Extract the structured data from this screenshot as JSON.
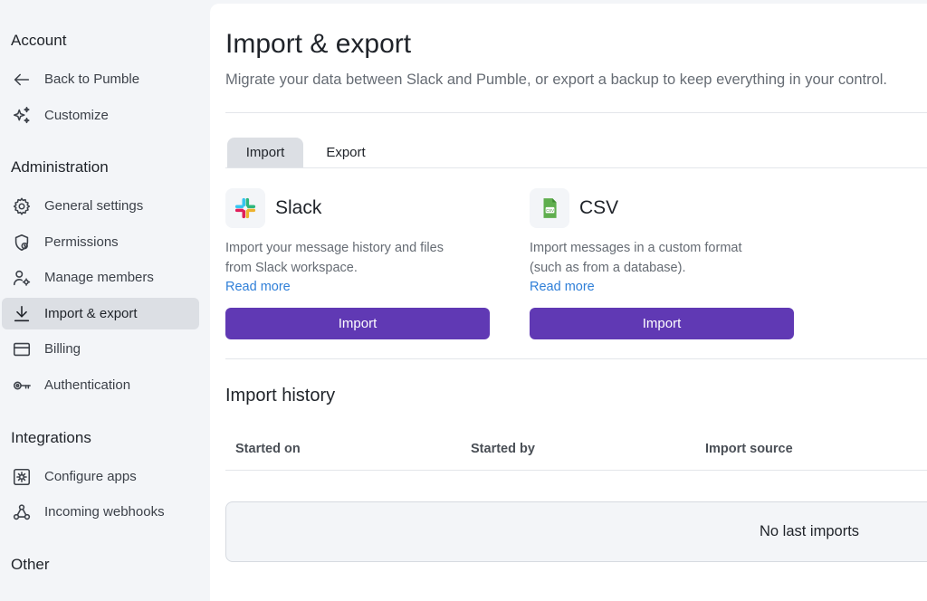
{
  "sidebar": {
    "account_title": "Account",
    "account_items": [
      {
        "label": "Back to Pumble",
        "icon": "arrow-left-icon"
      },
      {
        "label": "Customize",
        "icon": "sparkle-icon"
      }
    ],
    "admin_title": "Administration",
    "admin_items": [
      {
        "label": "General settings",
        "icon": "gear-icon"
      },
      {
        "label": "Permissions",
        "icon": "shield-icon"
      },
      {
        "label": "Manage members",
        "icon": "user-gear-icon"
      },
      {
        "label": "Import & export",
        "icon": "download-icon",
        "active": true
      },
      {
        "label": "Billing",
        "icon": "credit-card-icon"
      },
      {
        "label": "Authentication",
        "icon": "key-icon"
      }
    ],
    "integrations_title": "Integrations",
    "integration_items": [
      {
        "label": "Configure apps",
        "icon": "app-gear-icon"
      },
      {
        "label": "Incoming webhooks",
        "icon": "webhook-icon"
      }
    ],
    "other_title": "Other"
  },
  "main": {
    "title": "Import & export",
    "subtitle": "Migrate your data between Slack and Pumble, or export a backup to keep everything in your control.",
    "tabs": [
      {
        "label": "Import",
        "active": true
      },
      {
        "label": "Export",
        "active": false
      }
    ],
    "cards": [
      {
        "title": "Slack",
        "icon": "slack-logo-icon",
        "desc_line1": "Import your message history and files",
        "desc_line2": "from Slack workspace.",
        "link": "Read more",
        "button": "Import"
      },
      {
        "title": "CSV",
        "icon": "csv-file-icon",
        "desc_line1": "Import messages in a custom format",
        "desc_line2": "(such as from a database).",
        "link": "Read more",
        "button": "Import"
      }
    ],
    "history": {
      "title": "Import history",
      "columns": [
        "Started on",
        "Started by",
        "Import source"
      ],
      "empty_text": "No last imports"
    }
  },
  "colors": {
    "accent": "#6039b4",
    "link": "#2f7fd8",
    "background": "#f3f5f8",
    "active_item": "#dcdfe4"
  }
}
